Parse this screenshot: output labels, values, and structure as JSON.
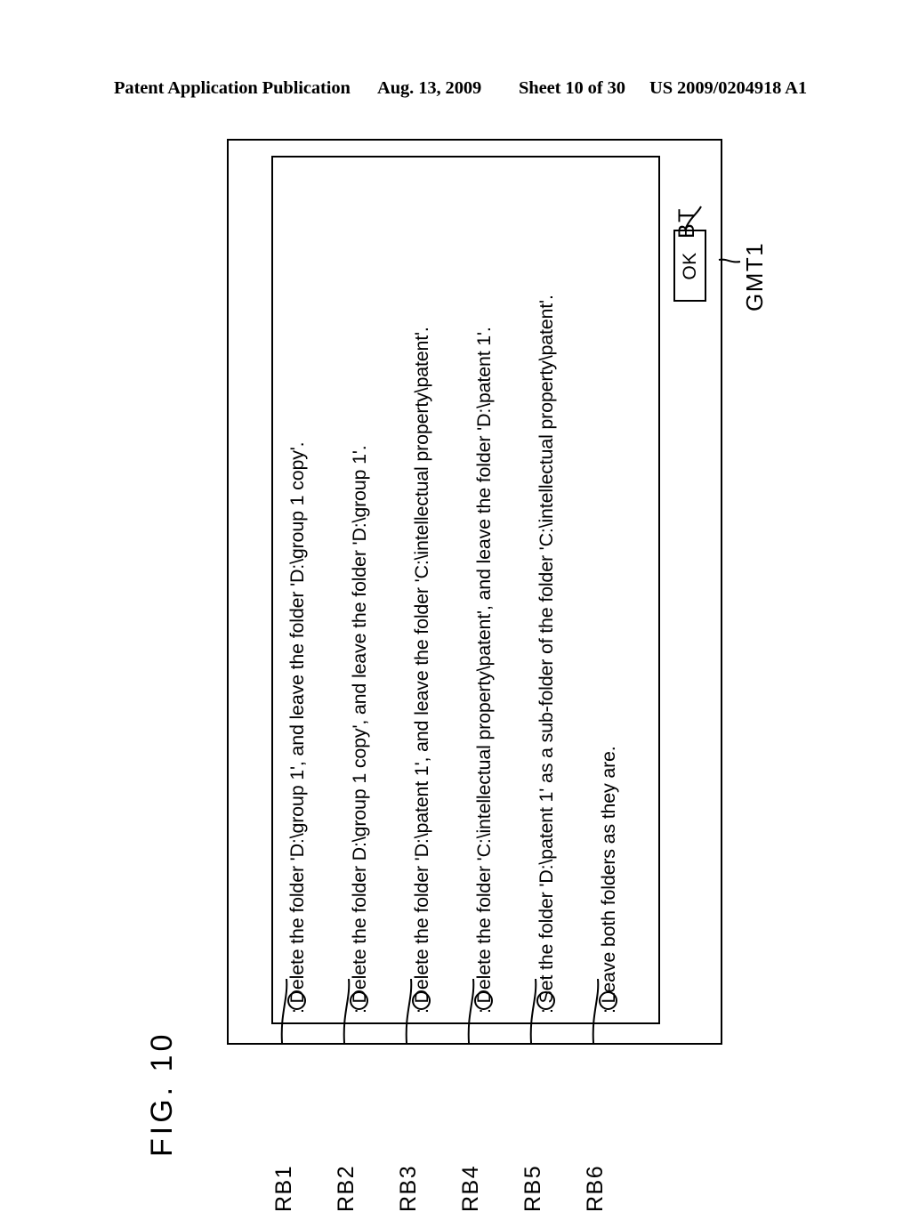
{
  "header": {
    "publication": "Patent Application Publication",
    "date": "Aug. 13, 2009",
    "sheet": "Sheet 10 of 30",
    "document_number": "US 2009/0204918 A1"
  },
  "figure": {
    "label": "FIG. 10"
  },
  "dialog": {
    "reference": "GMT1",
    "options": [
      {
        "ref": "RB1",
        "text": ": Delete the folder 'D:\\group 1', and leave the folder 'D:\\group 1 copy'.",
        "selected": false
      },
      {
        "ref": "RB2",
        "text": ": Delete the folder D:\\group 1 copy', and leave the folder 'D:\\group 1'.",
        "selected": false
      },
      {
        "ref": "RB3",
        "text": ": Delete the folder 'D:\\patent 1', and leave the folder 'C:\\intellectual property\\patent'.",
        "selected": false
      },
      {
        "ref": "RB4",
        "text": ": Delete the folder 'C:\\intellectual property\\patent', and leave the folder 'D:\\patent 1'.",
        "selected": false
      },
      {
        "ref": "RB5",
        "text": ": Set the folder 'D:\\patent 1' as a sub-folder of the folder 'C:\\intellectual property\\patent'.",
        "selected": false
      },
      {
        "ref": "RB6",
        "text": ": Leave both folders as they are.",
        "selected": false
      }
    ],
    "button": {
      "label": "OK",
      "reference": "BT"
    }
  },
  "colors": {
    "ink": "#000000",
    "paper": "#ffffff"
  }
}
